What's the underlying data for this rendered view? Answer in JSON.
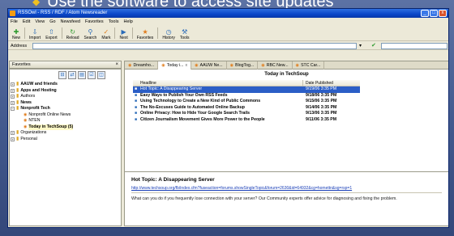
{
  "slide": {
    "bullet": "◆",
    "title": "Use the software to access site updates"
  },
  "window": {
    "title": "RSSOwl - RSS / RDF / Atom Newsreader",
    "controls": [
      "_",
      "□",
      "x"
    ]
  },
  "menu": [
    "File",
    "Edit",
    "View",
    "Go",
    "Newsfeed",
    "Favorites",
    "Tools",
    "Help"
  ],
  "toolbar": {
    "items": [
      {
        "label": "New",
        "icon": "✚"
      },
      {
        "label": "Import",
        "icon": "⇩"
      },
      {
        "label": "Export",
        "icon": "⇧"
      },
      {
        "label": "Reload",
        "icon": "↻"
      },
      {
        "label": "Search",
        "icon": "⚲"
      },
      {
        "label": "Mark",
        "icon": "✓"
      },
      {
        "label": "Next",
        "icon": "▶"
      },
      {
        "label": "Favorites",
        "icon": "★"
      },
      {
        "label": "History",
        "icon": "◷"
      },
      {
        "label": "Tools",
        "icon": "⚒"
      }
    ]
  },
  "address": {
    "label": "Address",
    "value": "",
    "search_value": ""
  },
  "favorites": {
    "header": "Favorites",
    "items": [
      {
        "label": "AAUW and friends",
        "bold": true,
        "expander": "+",
        "type": "folder",
        "indent": 0
      },
      {
        "label": "Apps and Hosting",
        "bold": true,
        "expander": "+",
        "type": "folder",
        "indent": 0
      },
      {
        "label": "Authors",
        "bold": false,
        "expander": "+",
        "type": "folder",
        "indent": 0
      },
      {
        "label": "News",
        "bold": true,
        "expander": "+",
        "type": "folder",
        "indent": 0
      },
      {
        "label": "Nonprofit Tech",
        "bold": true,
        "expander": "−",
        "type": "folder",
        "indent": 0
      },
      {
        "label": "Nonprofit Online News",
        "bold": false,
        "expander": "",
        "type": "feed",
        "indent": 1
      },
      {
        "label": "NTEN",
        "bold": false,
        "expander": "",
        "type": "feed",
        "indent": 1
      },
      {
        "label": "Today in TechSoup (5)",
        "bold": true,
        "expander": "",
        "type": "feed",
        "indent": 1,
        "selected": true
      },
      {
        "label": "Organizations",
        "bold": false,
        "expander": "+",
        "type": "folder",
        "indent": 0
      },
      {
        "label": "Personal",
        "bold": false,
        "expander": "+",
        "type": "folder",
        "indent": 0
      }
    ]
  },
  "tabs": [
    {
      "label": "Dreamho...",
      "close": ""
    },
    {
      "label": "Today i...",
      "close": "x",
      "active": true
    },
    {
      "label": "AAUW Ne...",
      "close": ""
    },
    {
      "label": "BlogTog...",
      "close": ""
    },
    {
      "label": "RBC New...",
      "close": ""
    },
    {
      "label": "STC Car...",
      "close": ""
    }
  ],
  "feed": {
    "title": "Today in TechSoup",
    "columns": {
      "headline": "Headline",
      "date": "Date Published"
    },
    "rows": [
      {
        "headline": "Hot Topic: A Disappearing Server",
        "date": "9/19/06 3:35 PM",
        "selected": true,
        "bold": false
      },
      {
        "headline": "Easy Ways to Publish Your Own RSS Feeds",
        "date": "9/18/06 3:35 PM",
        "selected": false,
        "bold": true
      },
      {
        "headline": "Using Technology to Create a New Kind of Public Commons",
        "date": "9/15/06 3:35 PM",
        "selected": false,
        "bold": true
      },
      {
        "headline": "The No-Excuses Guide to Automated Online Backup",
        "date": "9/14/06 3:35 PM",
        "selected": false,
        "bold": true
      },
      {
        "headline": "Online Privacy: How to Hide Your Google Search Trails",
        "date": "9/13/06 3:35 PM",
        "selected": false,
        "bold": true
      },
      {
        "headline": "Citizen Journalism Movement Gives More Power to the People",
        "date": "9/11/06 3:35 PM",
        "selected": false,
        "bold": true
      }
    ]
  },
  "preview": {
    "title": "Hot Topic: A Disappearing Server",
    "url": "http://www.techsoup.org/fb/index.cfm?fuseaction=forums.showSingleTopic&forum=2630&id=64932&cg=homettn&sg=rsp=1",
    "body": "What can you do if you frequently lose connection with your server? Our Community experts offer advice for diagnosing and fixing the problem."
  }
}
